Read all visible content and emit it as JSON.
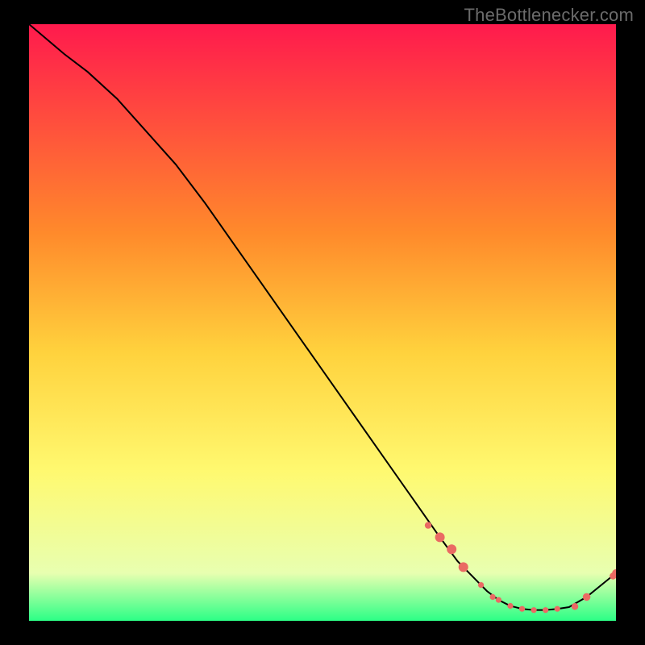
{
  "attribution": "TheBottlenecker.com",
  "colors": {
    "background": "#000000",
    "grad_top": "#ff1a4d",
    "grad_mid1": "#ff8a2b",
    "grad_mid2": "#ffd23d",
    "grad_mid3": "#fff970",
    "grad_mid4": "#e8ffb0",
    "grad_bot": "#2cff86",
    "curve": "#000000",
    "marker": "#ea6a63",
    "caption": "#6b6b6b"
  },
  "chart_data": {
    "type": "line",
    "title": "",
    "xlabel": "",
    "ylabel": "",
    "xlim": [
      0,
      100
    ],
    "ylim": [
      0,
      100
    ],
    "x": [
      0,
      6,
      10,
      15,
      20,
      25,
      30,
      35,
      40,
      45,
      50,
      55,
      60,
      65,
      70,
      73,
      75,
      78,
      80,
      82,
      84,
      86,
      88,
      90,
      92,
      95,
      100
    ],
    "y": [
      100,
      95,
      92,
      87.5,
      82,
      76.5,
      70,
      63,
      56,
      49,
      42,
      35,
      28,
      21,
      14,
      10,
      8,
      5,
      3.5,
      2.5,
      2,
      1.8,
      1.8,
      2,
      2.3,
      4,
      8
    ],
    "markers": {
      "x": [
        68,
        70,
        72,
        74,
        77,
        79,
        80,
        82,
        84,
        86,
        88,
        90,
        93,
        95,
        99.5,
        100
      ],
      "y": [
        16,
        14,
        12,
        9,
        6,
        4,
        3.5,
        2.5,
        2,
        1.8,
        1.8,
        2,
        2.4,
        4,
        7.5,
        8
      ],
      "r": [
        3.5,
        5,
        5,
        5,
        3,
        3,
        3,
        3,
        3,
        3,
        3,
        3,
        3.5,
        4,
        3.5,
        4
      ]
    }
  }
}
